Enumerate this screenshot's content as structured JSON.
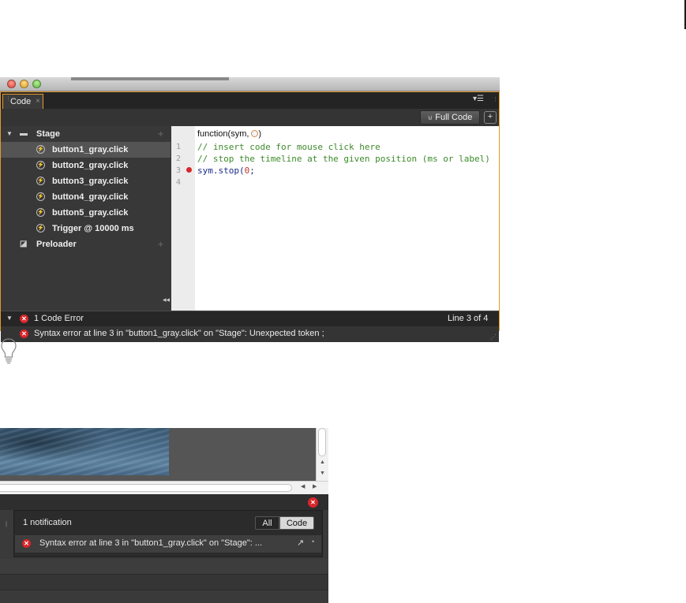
{
  "window1": {
    "tab_label": "Code",
    "tab_close": "×",
    "full_code_label": "Full Code",
    "sidebar": {
      "stage_label": "Stage",
      "items": [
        {
          "label": "button1_gray.click"
        },
        {
          "label": "button2_gray.click"
        },
        {
          "label": "button3_gray.click"
        },
        {
          "label": "button4_gray.click"
        },
        {
          "label": "button5_gray.click"
        },
        {
          "label": "Trigger @ 10000 ms"
        }
      ],
      "preloader_label": "Preloader"
    },
    "editor": {
      "function_header": "function(sym,",
      "line_numbers": [
        "1",
        "2",
        "3",
        "4"
      ],
      "lines": [
        "// insert code for mouse click here",
        "// stop the timeline at the given position (ms or label)",
        "sym.stop(",
        ""
      ],
      "line3_arg": "0",
      "line3_end": ";"
    },
    "error_bar": {
      "count_label": "1 Code Error",
      "line_position": "Line 3 of 4",
      "message": "Syntax error at line 3 in \"button1_gray.click\" on \"Stage\": Unexpected token ;"
    }
  },
  "window2": {
    "notification_title": "1 notification",
    "filter_all": "All",
    "filter_code": "Code",
    "notification_message": "Syntax error at line 3 in \"button1_gray.click\" on \"Stage\": ..."
  },
  "colors": {
    "panel_border": "#e49a2a",
    "error_red": "#d8262b",
    "comment_green": "#3c8a2a",
    "code_blue": "#1a2a8a"
  }
}
